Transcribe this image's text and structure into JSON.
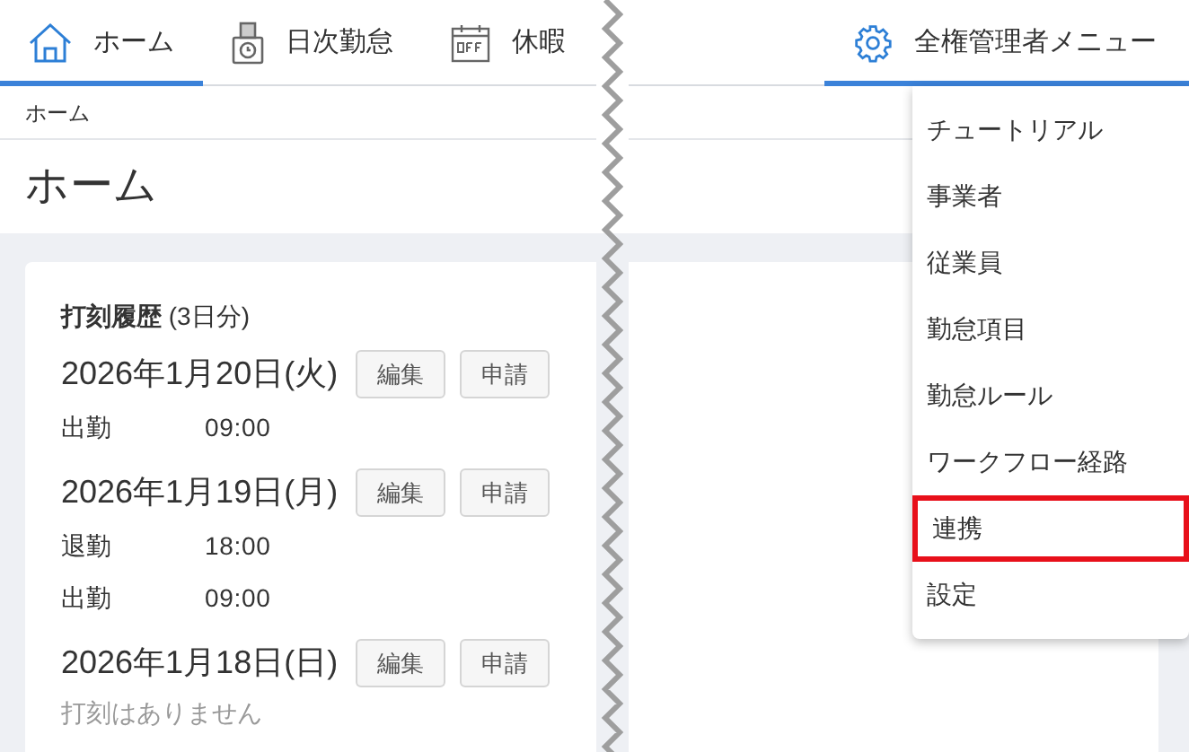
{
  "nav": {
    "tabs": [
      {
        "label": "ホーム",
        "kind": "home",
        "selected": true
      },
      {
        "label": "日次勤怠",
        "kind": "daily",
        "selected": false
      },
      {
        "label": "休暇",
        "kind": "leave",
        "selected": false
      }
    ]
  },
  "admin_menu": {
    "label": "全権管理者メニュー",
    "selected": true,
    "items": [
      {
        "label": "チュートリアル",
        "highlighted": false
      },
      {
        "label": "事業者",
        "highlighted": false
      },
      {
        "label": "従業員",
        "highlighted": false
      },
      {
        "label": "勤怠項目",
        "highlighted": false
      },
      {
        "label": "勤怠ルール",
        "highlighted": false
      },
      {
        "label": "ワークフロー経路",
        "highlighted": false
      },
      {
        "label": "連携",
        "highlighted": true
      },
      {
        "label": "設定",
        "highlighted": false
      }
    ]
  },
  "breadcrumb": [
    "ホーム"
  ],
  "page_title": "ホーム",
  "history": {
    "title": "打刻履歴",
    "count": "(3日分)",
    "days": [
      {
        "date": "2026年1月20日(火)",
        "buttons": [
          "編集",
          "申請"
        ],
        "entries": [
          {
            "type": "出勤",
            "time": "09:00"
          }
        ]
      },
      {
        "date": "2026年1月19日(月)",
        "buttons": [
          "編集",
          "申請"
        ],
        "entries": [
          {
            "type": "退勤",
            "time": "18:00"
          },
          {
            "type": "出勤",
            "time": "09:00"
          }
        ]
      },
      {
        "date": "2026年1月18日(日)",
        "buttons": [
          "編集",
          "申請"
        ],
        "empty_text": "打刻はありません"
      }
    ]
  }
}
